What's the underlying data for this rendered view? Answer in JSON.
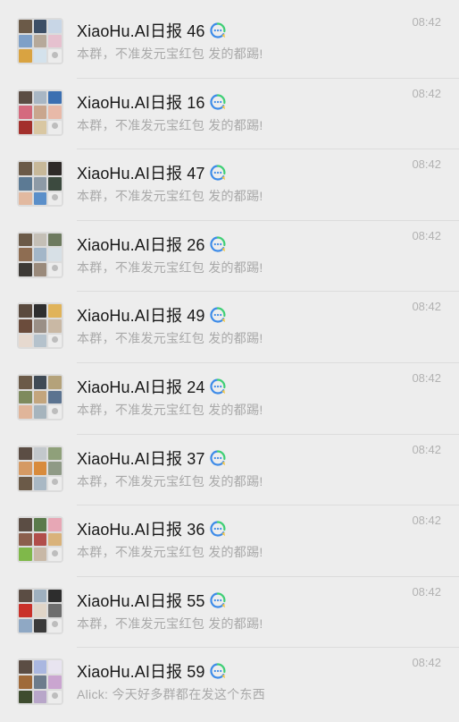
{
  "chats": [
    {
      "title": "XiaoHu.AI日报 46",
      "time": "08:42",
      "preview": "本群，不准发元宝红包 发的都踢!",
      "tiles": [
        "#6b5a48",
        "#3d4f66",
        "#c8d6e6",
        "#7fa0c7",
        "#b6a99a",
        "#e6c1cf",
        "#d9a341",
        "#d4e2ec",
        "blank"
      ]
    },
    {
      "title": "XiaoHu.AI日报 16",
      "time": "08:42",
      "preview": "本群，不准发元宝红包 发的都踢!",
      "tiles": [
        "#5b4d44",
        "#a8b6c4",
        "#3b6fb1",
        "#d46a7e",
        "#c9a68e",
        "#e8b9a8",
        "#a3302c",
        "#d9c7a2",
        "blank"
      ]
    },
    {
      "title": "XiaoHu.AI日报 47",
      "time": "08:42",
      "preview": "本群，不准发元宝红包 发的都踢!",
      "tiles": [
        "#6b5a48",
        "#c7b899",
        "#2e2a28",
        "#5c7a94",
        "#8d9aa6",
        "#3c4a3f",
        "#e2b9a0",
        "#5b8fc9",
        "blank"
      ]
    },
    {
      "title": "XiaoHu.AI日报 26",
      "time": "08:42",
      "preview": "本群，不准发元宝红包 发的都踢!",
      "tiles": [
        "#6b5a48",
        "#c4bfb6",
        "#6d7a5f",
        "#8e6d52",
        "#a3b6c8",
        "#d7e0e6",
        "#3d3a36",
        "#9a8a7b",
        "blank"
      ]
    },
    {
      "title": "XiaoHu.AI日报 49",
      "time": "08:42",
      "preview": "本群，不准发元宝红包 发的都踢!",
      "tiles": [
        "#5a4a3e",
        "#2f2f2f",
        "#e0b35a",
        "#6b4c3c",
        "#9a8f86",
        "#c9b8a4",
        "#e6d9cf",
        "#b5c2cc",
        "blank"
      ]
    },
    {
      "title": "XiaoHu.AI日报 24",
      "time": "08:42",
      "preview": "本群，不准发元宝红包 发的都踢!",
      "tiles": [
        "#6b5a48",
        "#3f4a55",
        "#b4a27a",
        "#7e8a5d",
        "#c3a57d",
        "#5b7390",
        "#e0b59a",
        "#a6b4bd",
        "blank"
      ]
    },
    {
      "title": "XiaoHu.AI日报 37",
      "time": "08:42",
      "preview": "本群，不准发元宝红包 发的都踢!",
      "tiles": [
        "#5b4d44",
        "#c3c8cc",
        "#8fa07a",
        "#d59a64",
        "#d88b3c",
        "#8f9a86",
        "#6b5a48",
        "#a9b8c4",
        "blank"
      ]
    },
    {
      "title": "XiaoHu.AI日报 36",
      "time": "08:42",
      "preview": "本群，不准发元宝红包 发的都踢!",
      "tiles": [
        "#5b4d44",
        "#5a7a4b",
        "#e7a7b5",
        "#8b5f4d",
        "#b14e4a",
        "#d9b27a",
        "#7fb84a",
        "#c8b8a6",
        "blank"
      ]
    },
    {
      "title": "XiaoHu.AI日报 55",
      "time": "08:42",
      "preview": "本群，不准发元宝红包 发的都踢!",
      "tiles": [
        "#5b4d44",
        "#9fb0bf",
        "#2d2d2d",
        "#c9312a",
        "#e0d5c8",
        "#6d6d6d",
        "#8fa8c4",
        "#3b3b3b",
        "blank"
      ]
    },
    {
      "title": "XiaoHu.AI日报 59",
      "time": "08:42",
      "preview": "Alick: 今天好多群都在发这个东西",
      "tiles": [
        "#5b4d44",
        "#aab7e0",
        "#e8e4f0",
        "#9f6a3a",
        "#6d7c8c",
        "#caa5d0",
        "#3e4c2f",
        "#b8a6c9",
        "blank"
      ]
    }
  ],
  "colors": {
    "badge_blue": "#3d8be8",
    "badge_green": "#3fcf76",
    "badge_yellow": "#f5c543"
  },
  "icons": {
    "badge": "colorful-speech-bubble-icon",
    "placeholder": "default-avatar-icon"
  }
}
